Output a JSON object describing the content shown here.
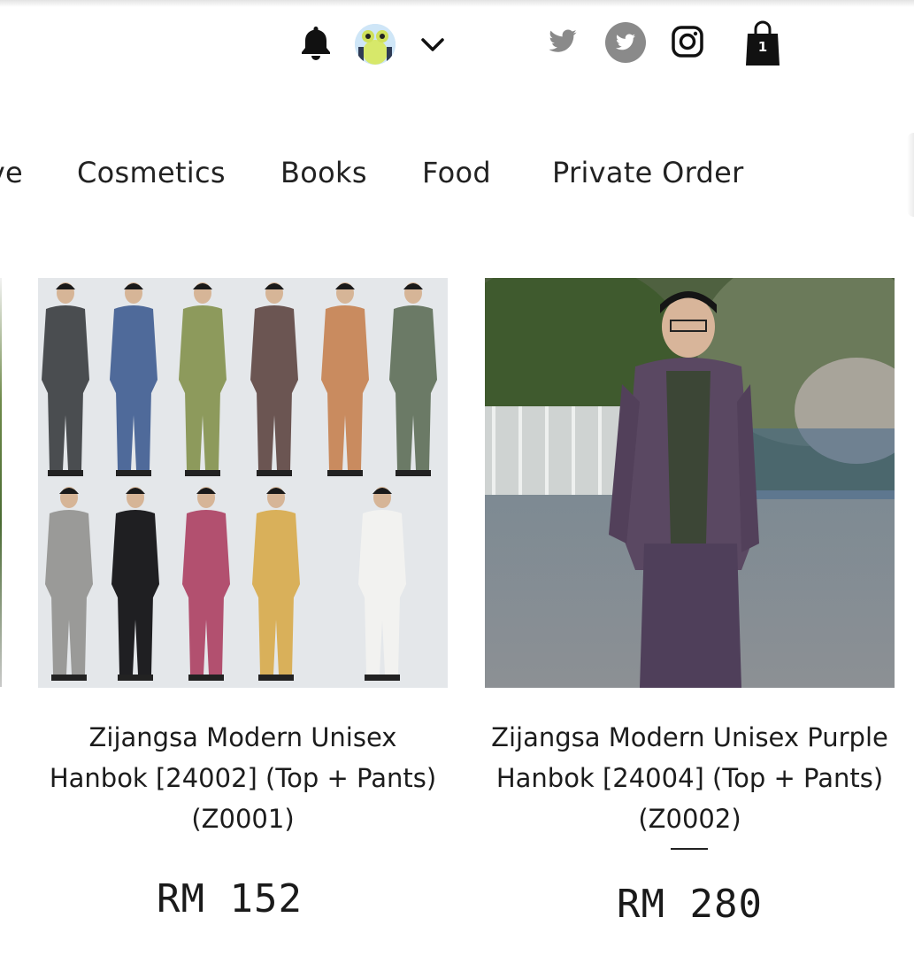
{
  "header": {
    "icons": [
      "notification-bell-icon",
      "user-avatar",
      "chevron-down-icon",
      "twitter-icon",
      "twitter-circle-icon",
      "instagram-icon",
      "shopping-bag-icon"
    ],
    "cart_count": "1"
  },
  "nav": {
    "items": [
      {
        "label": "ve"
      },
      {
        "label": "Cosmetics"
      },
      {
        "label": "Books"
      },
      {
        "label": "Food"
      },
      {
        "label": "Private Order"
      }
    ]
  },
  "products": [
    {
      "title": "Zijangsa Modern Unisex Hanbok [24002] (Top + Pants) (Z0001)",
      "price": "RM 152"
    },
    {
      "title": "Zijangsa Modern Unisex Purple Hanbok [24004] (Top + Pants)(Z0002)",
      "price": "RM 280"
    }
  ],
  "colors": {
    "social_grey": "#8a8a8a",
    "text": "#1b1b1b",
    "swatches": [
      "#4a4d50",
      "#4f6a9a",
      "#8d9a5c",
      "#6b5552",
      "#c98b5f",
      "#6b7a66",
      "#9a9a98",
      "#1f1f22",
      "#b2506f",
      "#d9b05a",
      "#f2f2f0"
    ],
    "purple_outfit": "#5a4862"
  }
}
